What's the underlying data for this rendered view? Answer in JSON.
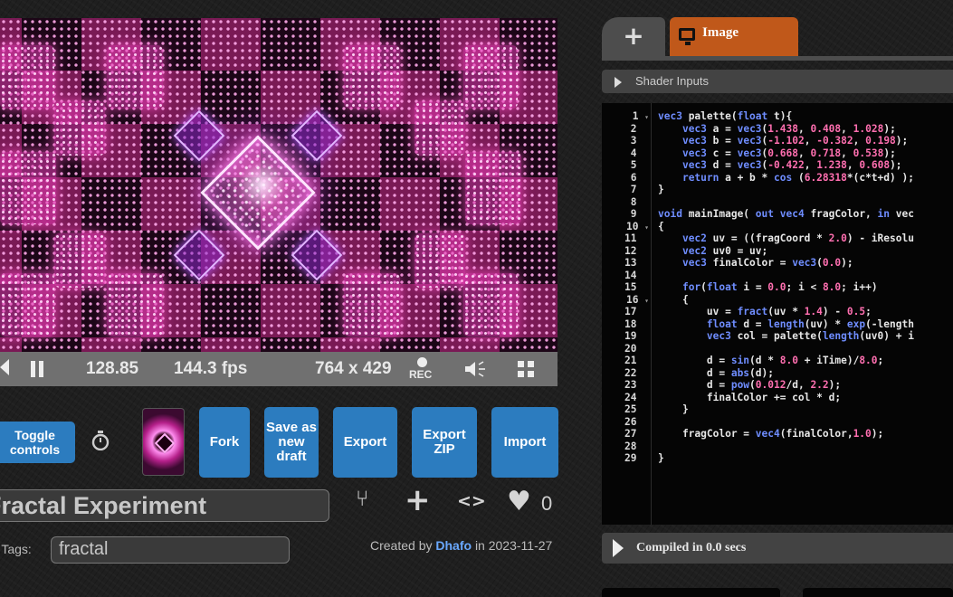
{
  "player": {
    "time": "128.85",
    "fps": "144.3 fps",
    "resolution": "764 x 429",
    "rec_label": "REC"
  },
  "actions": {
    "toggle_controls": "Toggle controls",
    "fork": "Fork",
    "save_draft": "Save as new draft",
    "export": "Export",
    "export_zip": "Export ZIP",
    "import": "Import"
  },
  "shader": {
    "title": "Fractal Experiment",
    "likes": "0",
    "tags_label": "6, Tags:",
    "tags": "fractal",
    "created_by_prefix": "Created by",
    "author": "Dhafo",
    "created_suffix": "in 2023-11-27"
  },
  "editor": {
    "add_tab": "+",
    "tab_label": "Image",
    "shader_inputs": "Shader Inputs",
    "compile_status": "Compiled in 0.0 secs",
    "code": [
      "vec3 palette(float t){",
      "    vec3 a = vec3(1.438, 0.408, 1.028);",
      "    vec3 b = vec3(-1.102, -0.382, 0.198);",
      "    vec3 c = vec3(0.668, 0.718, 0.538);",
      "    vec3 d = vec3(-0.422, 1.238, 0.608);",
      "    return a + b * cos (6.28318*(c*t+d) );",
      "}",
      "",
      "void mainImage( out vec4 fragColor, in vec",
      "{",
      "    vec2 uv = ((fragCoord * 2.0) - iResolu",
      "    vec2 uv0 = uv;",
      "    vec3 finalColor = vec3(0.0);",
      "",
      "    for(float i = 0.0; i < 8.0; i++)",
      "    {",
      "        uv = fract(uv * 1.4) - 0.5;",
      "        float d = length(uv) * exp(-length",
      "        vec3 col = palette(length(uv0) + i",
      "",
      "        d = sin(d * 8.0 + iTime)/8.0;",
      "        d = abs(d);",
      "        d = pow(0.012/d, 2.2);",
      "        finalColor += col * d;",
      "    }",
      "",
      "    fragColor = vec4(finalColor,1.0);",
      "",
      "}"
    ],
    "fold_lines": [
      1,
      10,
      16
    ]
  },
  "icons": {
    "rewind": "rewind-icon",
    "pause": "pause-icon",
    "record": "record-icon",
    "volume": "volume-icon",
    "fullscreen": "fullscreen-icon",
    "timer": "stopwatch-icon",
    "fork": "fork-icon",
    "add": "add-icon",
    "embed": "embed-icon",
    "heart": "heart-icon",
    "monitor": "monitor-icon"
  },
  "colors": {
    "button_blue": "#2c7cbf",
    "tab_orange": "#c0581a",
    "author_link": "#6aa9ff",
    "keyword_blue": "#6f8dff",
    "number_pink": "#ff6fb0"
  }
}
